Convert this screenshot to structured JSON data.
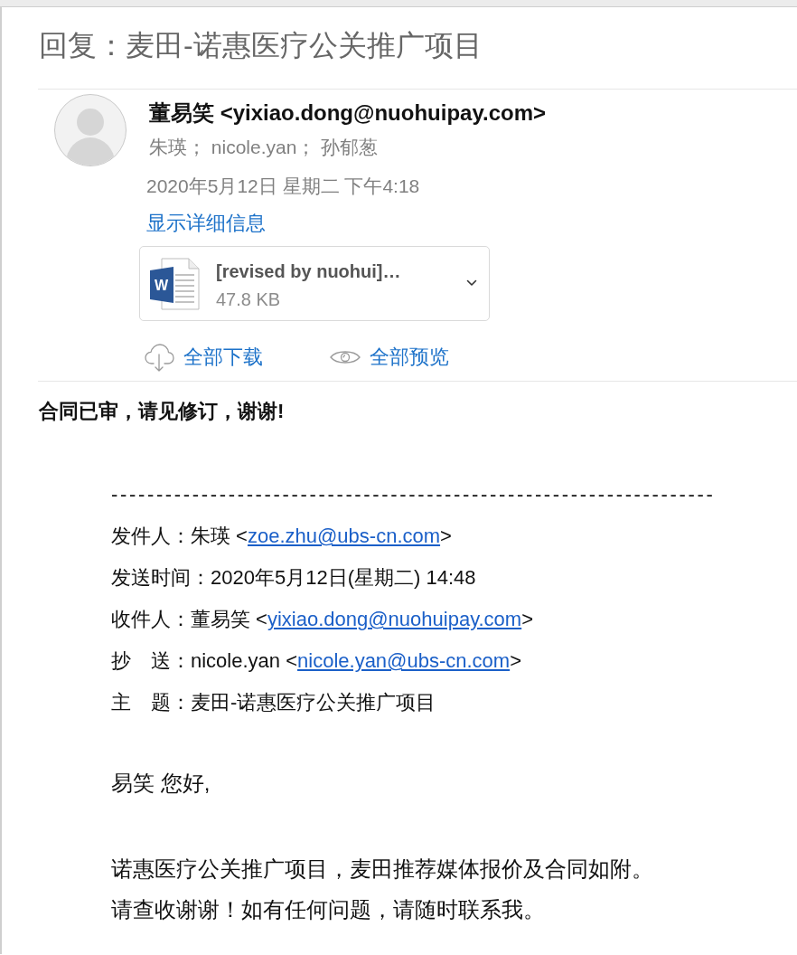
{
  "title": "回复：麦田-诺惠医疗公关推广项目",
  "header": {
    "sender": "董易笑 <yixiao.dong@nuohuipay.com>",
    "recipients": "朱瑛； nicole.yan； 孙郁葱",
    "date": "2020年5月12日 星期二 下午4:18",
    "details_link": "显示详细信息"
  },
  "attachment": {
    "icon_letter": "W",
    "name": "[revised by nuohui]…",
    "size": "47.8 KB"
  },
  "actions": [
    {
      "kind": "download",
      "label": "全部下载"
    },
    {
      "kind": "preview",
      "label": "全部预览"
    }
  ],
  "body": {
    "intro": "合同已审，请见修订，谢谢!",
    "separator": "-------------------------------------------------------------------",
    "quoted_header": [
      {
        "label": "发件人：",
        "text": "朱瑛 <",
        "link": "zoe.zhu@ubs-cn.com",
        "text_after": ">"
      },
      {
        "label": "发送时间：",
        "text": "2020年5月12日(星期二) 14:48"
      },
      {
        "label": "收件人：",
        "text": "董易笑 <",
        "link": "yixiao.dong@nuohuipay.com",
        "text_after": ">"
      },
      {
        "label": "抄　送：",
        "text": "nicole.yan <",
        "link": "nicole.yan@ubs-cn.com",
        "text_after": ">"
      },
      {
        "label": "主　题：",
        "text": "麦田-诺惠医疗公关推广项目"
      }
    ],
    "greeting": "易笑 您好,",
    "paragraph_lines": [
      "诺惠医疗公关推广项目，麦田推荐媒体报价及合同如附。",
      "请查收谢谢！如有任何问题，请随时联系我。"
    ]
  }
}
